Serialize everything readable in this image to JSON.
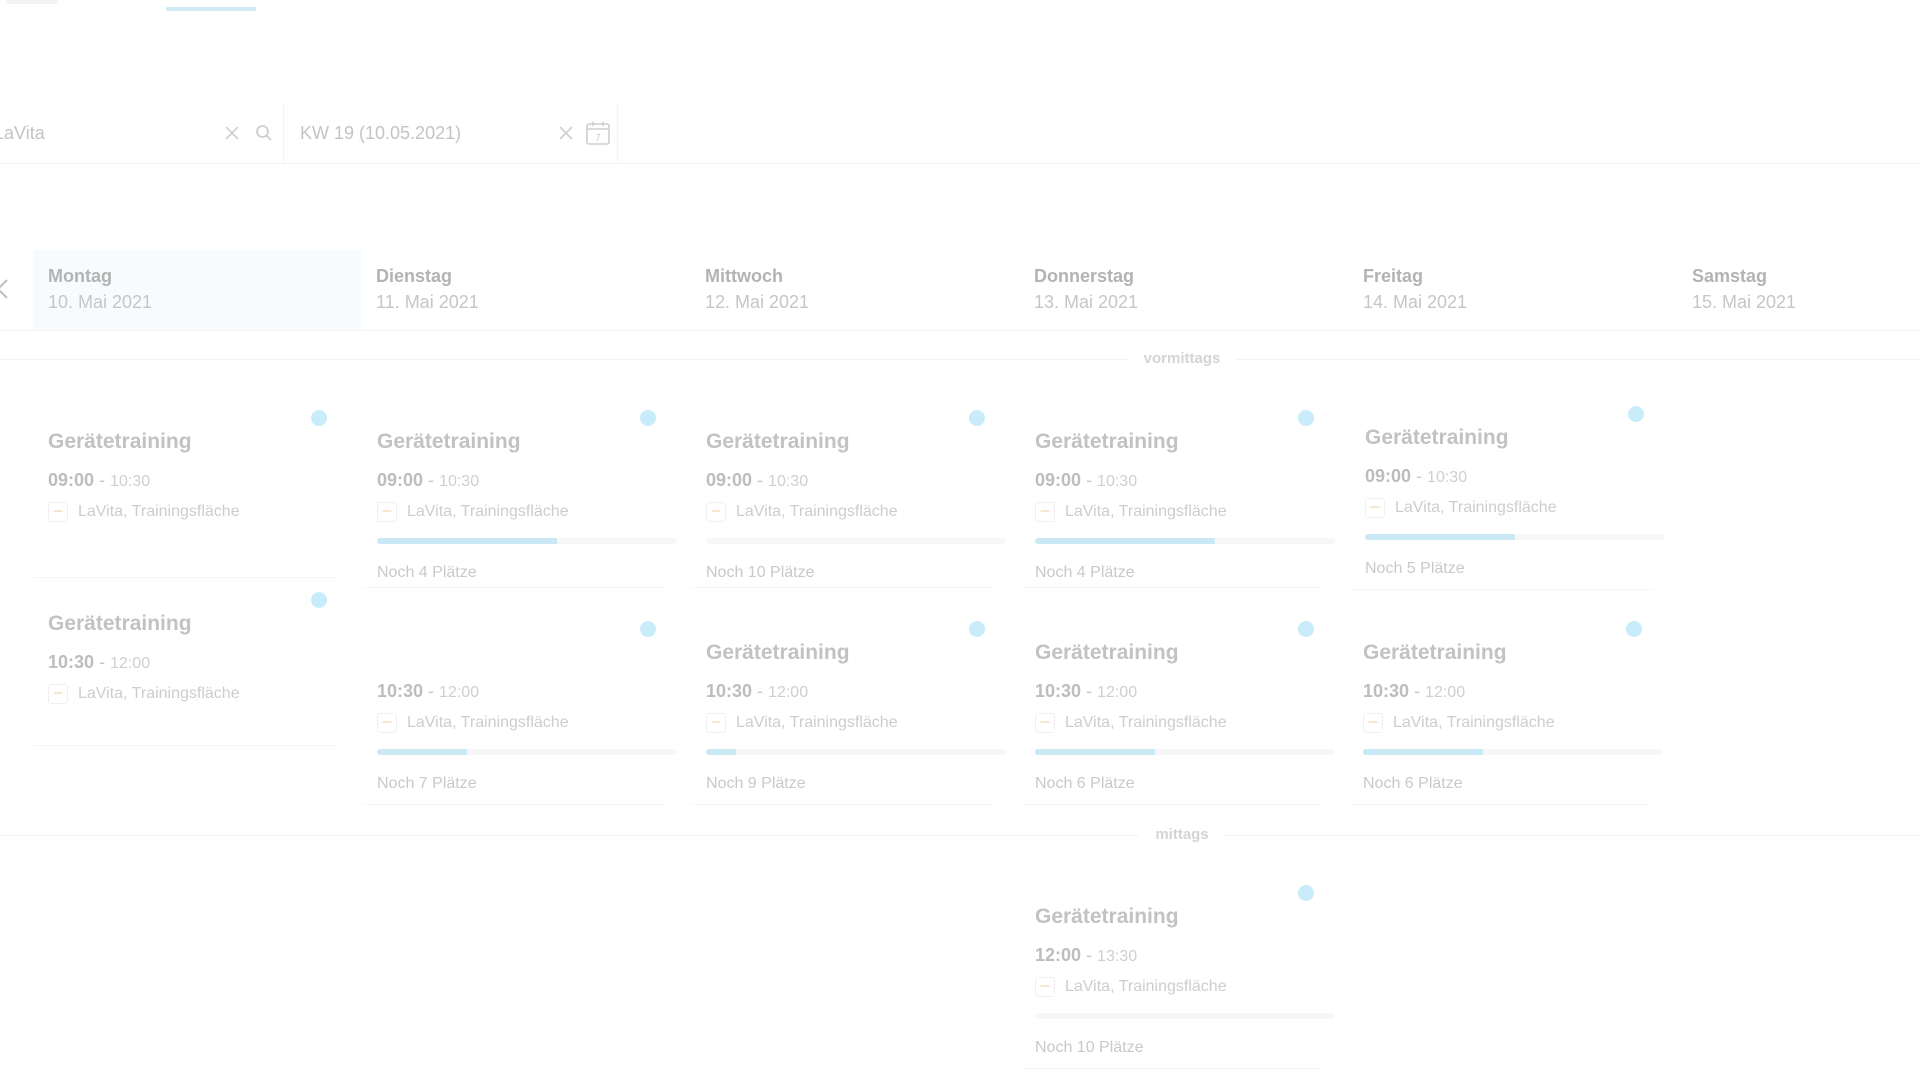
{
  "search": {
    "location_value": "LaVita",
    "week_value": "KW 19 (10.05.2021)"
  },
  "icons": {
    "clear": "close-icon",
    "search": "search-icon",
    "calendar": "calendar-icon",
    "calendar_digit": "7",
    "prev": "chevron-left-icon"
  },
  "colors": {
    "accent": "#c9ecfa",
    "progress": "#cbe9f5"
  },
  "days": [
    {
      "name": "Montag",
      "date": "10. Mai 2021",
      "selected": true
    },
    {
      "name": "Dienstag",
      "date": "11. Mai 2021"
    },
    {
      "name": "Mittwoch",
      "date": "12. Mai 2021"
    },
    {
      "name": "Donnerstag",
      "date": "13. Mai 2021"
    },
    {
      "name": "Freitag",
      "date": "14. Mai 2021"
    },
    {
      "name": "Samstag",
      "date": "15. Mai 2021"
    }
  ],
  "sections": {
    "morning": "vormittags",
    "noon": "mittags"
  },
  "cards": [
    {
      "title": "Gerätetraining",
      "start": "09:00",
      "sep": " - ",
      "end": "10:30",
      "location": "LaVita, Trainingsfläche"
    },
    {
      "title": "Gerätetraining",
      "start": "10:30",
      "sep": " - ",
      "end": "12:00",
      "location": "LaVita, Trainingsfläche"
    },
    {
      "title": "Gerätetraining",
      "start": "09:00",
      "sep": " - ",
      "end": "10:30",
      "location": "LaVita, Trainingsfläche",
      "places": "Noch 4 Plätze",
      "fill": 0.6
    },
    {
      "title": "",
      "start": "10:30",
      "sep": " - ",
      "end": "12:00",
      "location": "LaVita, Trainingsfläche",
      "places": "Noch 7 Plätze",
      "fill": 0.3
    },
    {
      "title": "Gerätetraining",
      "start": "09:00",
      "sep": " - ",
      "end": "10:30",
      "location": "LaVita, Trainingsfläche",
      "places": "Noch 10 Plätze",
      "fill": 0.0
    },
    {
      "title": "Gerätetraining",
      "start": "10:30",
      "sep": " - ",
      "end": "12:00",
      "location": "LaVita, Trainingsfläche",
      "places": "Noch 9 Plätze",
      "fill": 0.1
    },
    {
      "title": "Gerätetraining",
      "start": "09:00",
      "sep": " - ",
      "end": "10:30",
      "location": "LaVita, Trainingsfläche",
      "places": "Noch 4 Plätze",
      "fill": 0.6
    },
    {
      "title": "Gerätetraining",
      "start": "10:30",
      "sep": " - ",
      "end": "12:00",
      "location": "LaVita, Trainingsfläche",
      "places": "Noch 6 Plätze",
      "fill": 0.4
    },
    {
      "title": "Gerätetraining",
      "start": "12:00",
      "sep": " - ",
      "end": "13:30",
      "location": "LaVita, Trainingsfläche",
      "places": "Noch 10 Plätze",
      "fill": 0.0
    },
    {
      "title": "Gerätetraining",
      "start": "09:00",
      "sep": " - ",
      "end": "10:30",
      "location": "LaVita, Trainingsfläche",
      "places": "Noch 5 Plätze",
      "fill": 0.5
    },
    {
      "title": "Gerätetraining",
      "start": "10:30",
      "sep": " - ",
      "end": "12:00",
      "location": "LaVita, Trainingsfläche",
      "places": "Noch 6 Plätze",
      "fill": 0.4
    }
  ]
}
